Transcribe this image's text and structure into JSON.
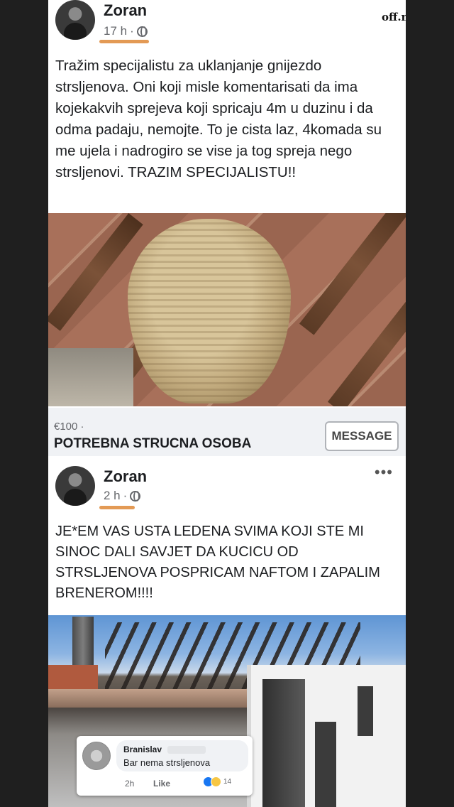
{
  "watermark": "off.net.mk",
  "post1": {
    "author": "Zoran",
    "time": "17 h",
    "separator": "·",
    "text": "Tražim specijalistu za uklanjanje gnijezdo strsljenova. Oni koji misle komentarisati da ima kojekakvih sprejeva koji spricaju 4m u duzinu i da odma padaju, nemojte. To je cista laz, 4komada su me ujela i nadrogiro se vise ja tog spreja nego strsljenovi. TRAZIM SPECIJALISTU!!",
    "listing": {
      "price": "€100 ·",
      "title": "POTREBNA STRUCNA OSOBA",
      "button_label": "MESSAGE"
    }
  },
  "post2": {
    "author": "Zoran",
    "time": "2 h",
    "separator": "·",
    "more": "•••",
    "text": "JE*EM VAS USTA LEDENA SVIMA KOJI STE MI SINOC DALI SAVJET DA KUCICU OD STRSLJENOVA POSPRICAM NAFTOM I ZAPALIM BRENEROM!!!!",
    "comment": {
      "name": "Branislav",
      "text": "Bar nema strsljenova",
      "time": "2h",
      "like_label": "Like",
      "reaction_count": "14"
    }
  },
  "icons": [
    "globe-icon",
    "more-icon",
    "like-reaction-icon",
    "haha-reaction-icon"
  ],
  "colors": {
    "underline_mark": "#e39a55",
    "listing_bg": "#f0f2f5"
  }
}
